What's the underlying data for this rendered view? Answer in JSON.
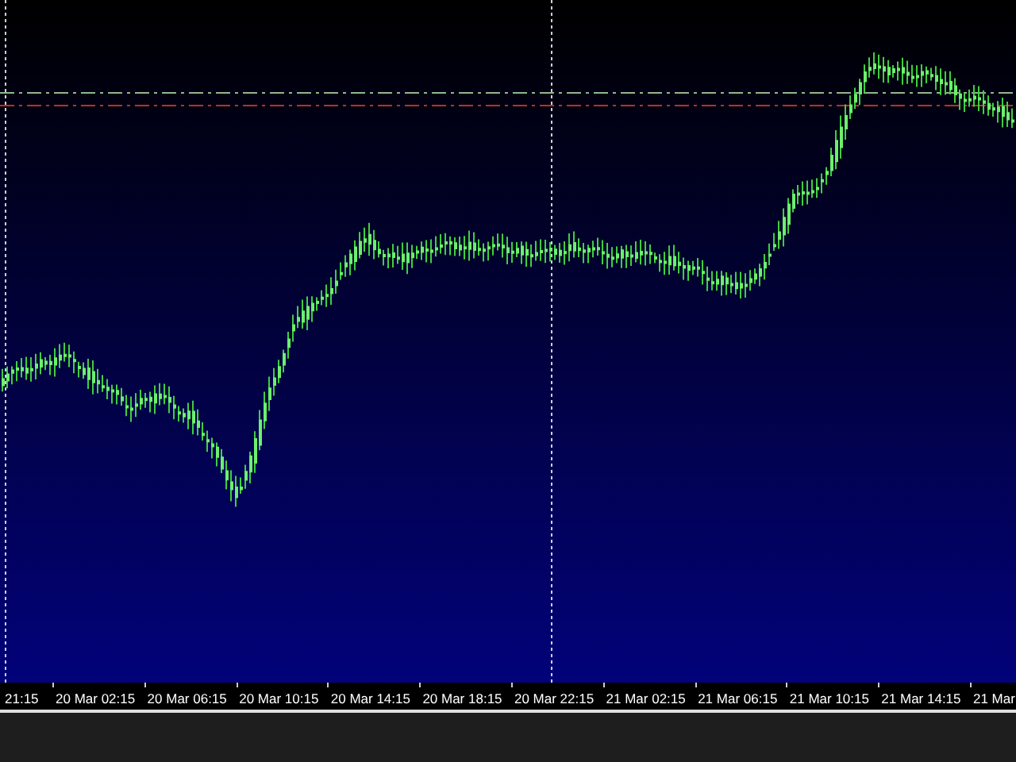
{
  "chart": {
    "time_axis_labels": [
      "21:15",
      "20 Mar 02:15",
      "20 Mar 06:15",
      "20 Mar 10:15",
      "20 Mar 14:15",
      "20 Mar 18:15",
      "20 Mar 22:15",
      "21 Mar 02:15",
      "21 Mar 06:15",
      "21 Mar 10:15",
      "21 Mar 14:15",
      "21 Mar"
    ]
  }
}
